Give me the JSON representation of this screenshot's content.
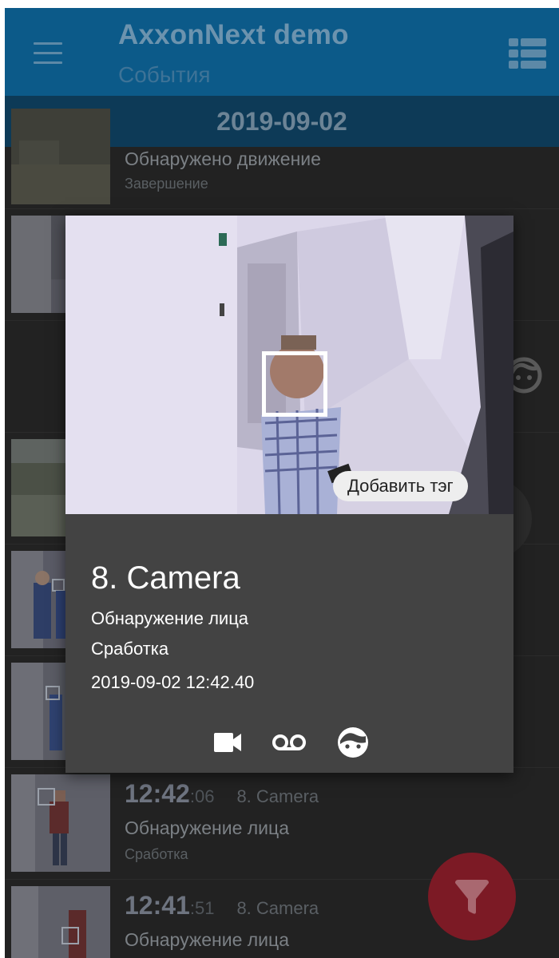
{
  "app": {
    "title": "AxxonNext demo",
    "subtitle": "События"
  },
  "date_header": "2019-09-02",
  "list": {
    "top_row": {
      "title": "Обнаружено движение",
      "subtitle": "Завершение"
    },
    "rows": [
      {
        "time_hm": "12:42",
        "time_sec": ":06",
        "camera": "8. Camera",
        "title": "Обнаружение лица",
        "subtitle": "Сработка"
      },
      {
        "time_hm": "12:41",
        "time_sec": ":51",
        "camera": "8. Camera",
        "title": "Обнаружение лица",
        "subtitle": ""
      }
    ]
  },
  "dialog": {
    "add_tag_label": "Добавить тэг",
    "camera": "8. Camera",
    "event": "Обнаружение лица",
    "phase": "Сработка",
    "timestamp": "2019-09-02 12:42.40",
    "actions": [
      "video-camera-icon",
      "voicemail-icon",
      "face-icon"
    ]
  },
  "colors": {
    "appbar": "#0c5a89",
    "date_bar": "#0d3a57",
    "dialog_bg": "#434343",
    "fab": "#7c1a25",
    "list_bg": "#222222"
  }
}
